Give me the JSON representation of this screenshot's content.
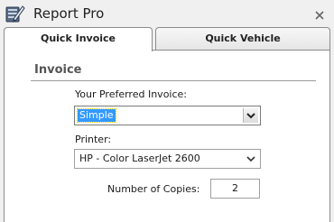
{
  "window": {
    "title": "Report Pro",
    "icon": "pen-logo-icon",
    "close_icon": "close-icon"
  },
  "tabs": [
    {
      "label": "Quick Invoice",
      "active": true
    },
    {
      "label": "Quick Vehicle",
      "active": false
    }
  ],
  "invoice_section": {
    "title": "Invoice",
    "preferred_invoice_label": "Your Preferred Invoice:",
    "preferred_invoice_value": "Simple",
    "printer_label": "Printer:",
    "printer_value": "HP - Color LaserJet 2600",
    "copies_label": "Number of Copies:",
    "copies_value": "2"
  },
  "colors": {
    "selection_highlight": "#3399ff",
    "section_title": "#555555"
  }
}
